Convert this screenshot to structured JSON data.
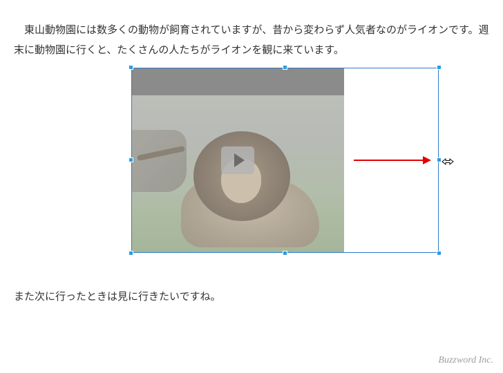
{
  "paragraphs": {
    "intro": "　東山動物園には数多くの動物が飼育されていますが、昔から変わらず人気者なのがライオンです。週末に動物園に行くと、たくさんの人たちがライオンを観に来ています。",
    "outro": "また次に行ったときは見に行きたいですね。"
  },
  "media": {
    "play_icon": "play"
  },
  "footer": {
    "brand": "Buzzword Inc."
  }
}
